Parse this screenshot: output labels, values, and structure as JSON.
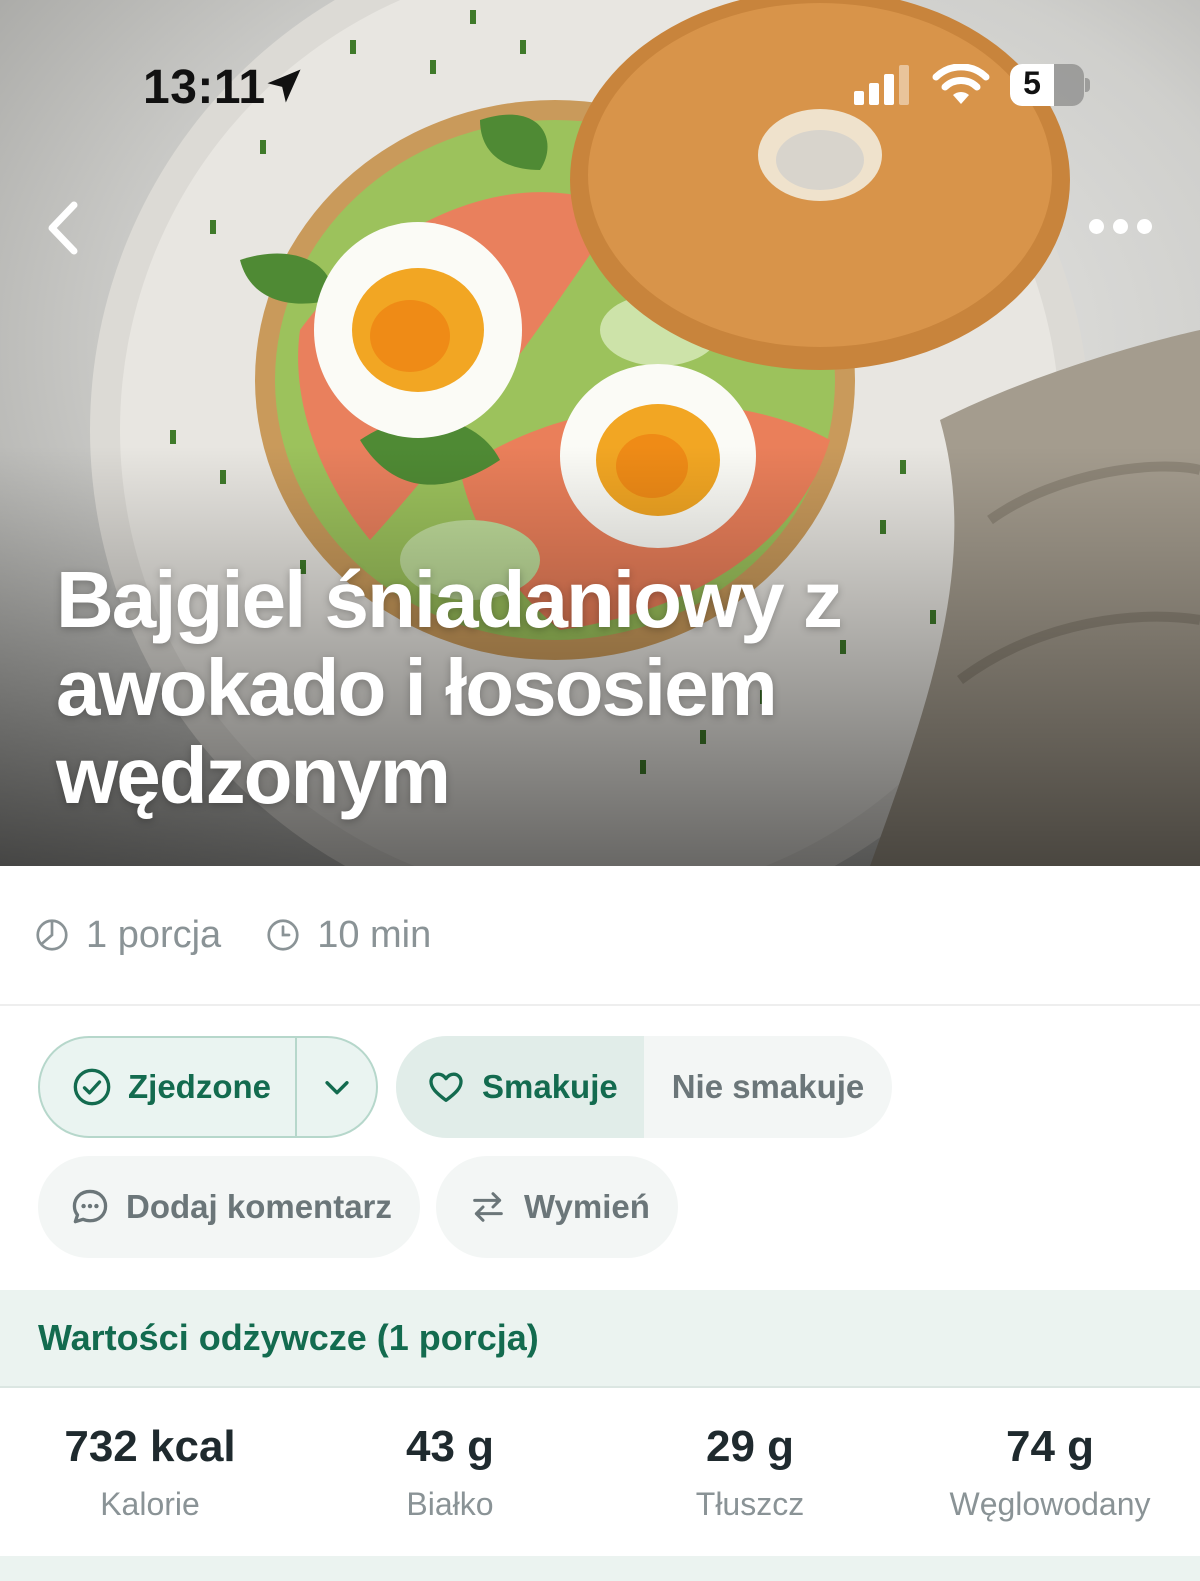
{
  "status_bar": {
    "time": "13:11",
    "battery": "5"
  },
  "hero": {
    "title": "Bajgiel śniadaniowy z awokado i łososiem wędzonym",
    "back_icon": "chevron-left-icon",
    "more_icon": "more-horizontal-icon"
  },
  "meta": {
    "portions": "1 porcja",
    "time": "10 min"
  },
  "actions": {
    "eaten_label": "Zjedzone",
    "like_label": "Smakuje",
    "dislike_label": "Nie smakuje",
    "comment_label": "Dodaj komentarz",
    "swap_label": "Wymień"
  },
  "nutrition": {
    "heading": "Wartości odżywcze (1 porcja)",
    "items": [
      {
        "value": "732 kcal",
        "label": "Kalorie"
      },
      {
        "value": "43 g",
        "label": "Białko"
      },
      {
        "value": "29 g",
        "label": "Tłuszcz"
      },
      {
        "value": "74 g",
        "label": "Węglowodany"
      }
    ]
  },
  "colors": {
    "accent": "#136b4f",
    "accent_bg": "#ebf3f0"
  }
}
